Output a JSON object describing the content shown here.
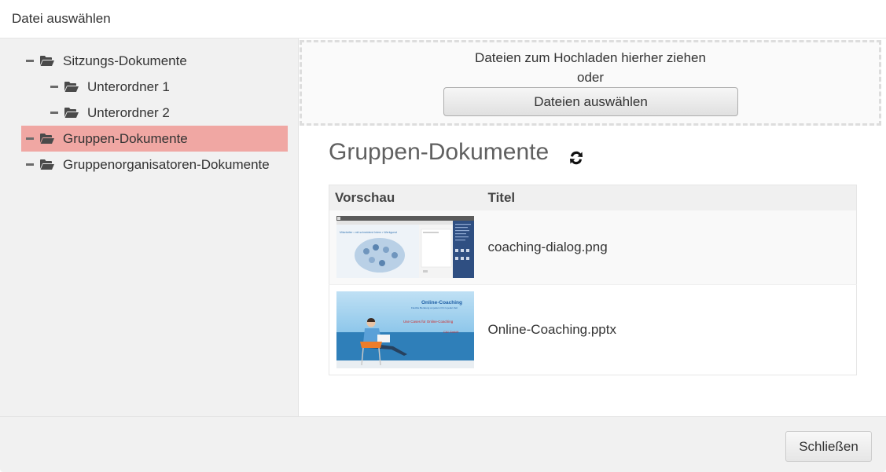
{
  "dialog": {
    "title": "Datei auswählen"
  },
  "tree": {
    "items": [
      {
        "label": "Sitzungs-Dokumente",
        "level": 0,
        "selected": false,
        "icon": "folder-open-icon"
      },
      {
        "label": "Unterordner 1",
        "level": 1,
        "selected": false,
        "icon": "folder-open-icon"
      },
      {
        "label": "Unterordner 2",
        "level": 1,
        "selected": false,
        "icon": "folder-open-icon"
      },
      {
        "label": "Gruppen-Dokumente",
        "level": 0,
        "selected": true,
        "icon": "folder-open-icon"
      },
      {
        "label": "Gruppenorganisatoren-Dokumente",
        "level": 0,
        "selected": false,
        "icon": "folder-open-icon"
      }
    ]
  },
  "upload": {
    "line1": "Dateien zum Hochladen hierher ziehen",
    "line2": "oder",
    "button_label": "Dateien auswählen"
  },
  "folder": {
    "title": "Gruppen-Dokumente",
    "refresh_icon": "refresh-icon"
  },
  "table": {
    "headers": {
      "preview": "Vorschau",
      "title": "Titel"
    },
    "rows": [
      {
        "title": "coaching-dialog.png",
        "preview": "screenshot-thumbnail"
      },
      {
        "title": "Online-Coaching.pptx",
        "preview": "presentation-thumbnail"
      }
    ]
  },
  "thumbnails": {
    "slide_title": "Online-Coaching",
    "slide_subtitle": "Flexible Beratung an jedem Ort zu jeder Zeit",
    "slide_line": "Use Cases für Online-Coaching",
    "slide_company": "CAI GmbH",
    "screenshot_banner": "Mitarbeiter • mit schneidend Intern • Werkgunst"
  },
  "footer": {
    "close_label": "Schließen"
  },
  "colors": {
    "selected_bg": "#f0a7a3",
    "tree_bg": "#f1f1f1",
    "header_row_bg": "#f0f0f0"
  }
}
